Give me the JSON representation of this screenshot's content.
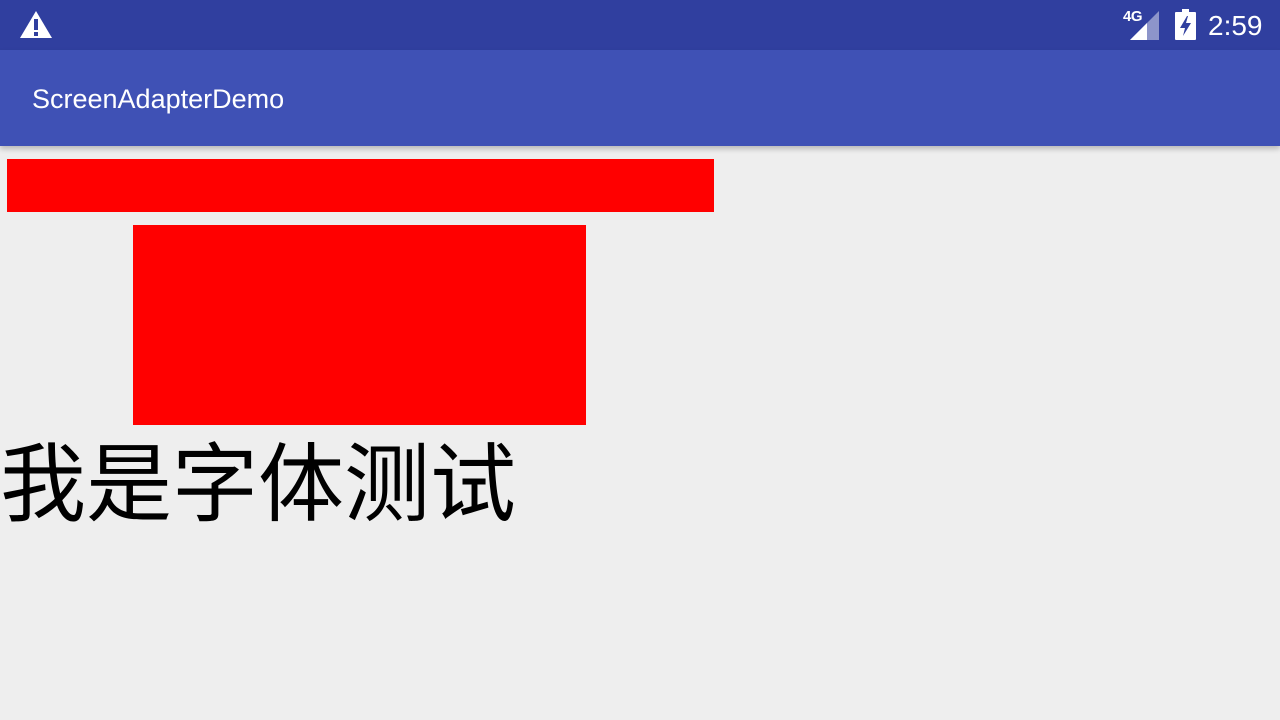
{
  "status_bar": {
    "network_type": "4G",
    "time": "2:59",
    "icons": [
      "warning-icon",
      "signal-icon",
      "battery-charging-icon"
    ],
    "color": "#303f9f"
  },
  "app_bar": {
    "title": "ScreenAdapterDemo",
    "color": "#3f51b5"
  },
  "content": {
    "block_color": "#ff0000",
    "font_test_text": "我是字体测试"
  }
}
